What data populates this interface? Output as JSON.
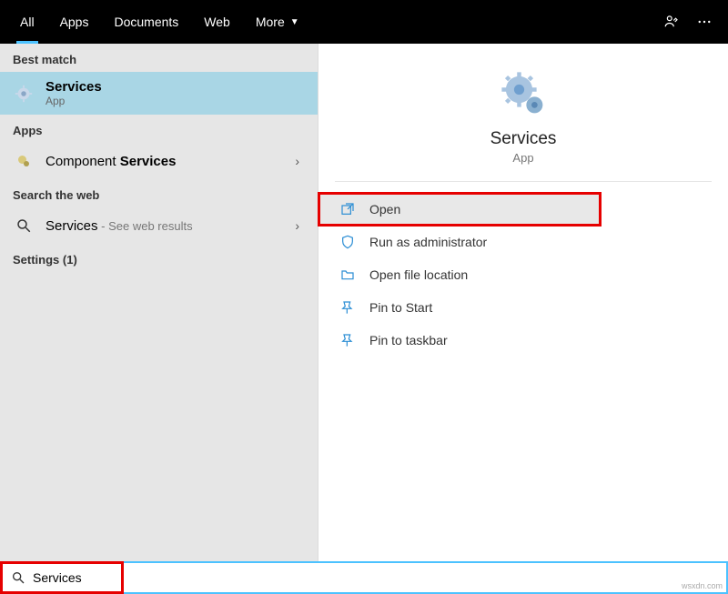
{
  "topbar": {
    "tabs": [
      "All",
      "Apps",
      "Documents",
      "Web",
      "More"
    ]
  },
  "left": {
    "best_match_label": "Best match",
    "best_match": {
      "title": "Services",
      "sub": "App"
    },
    "apps_label": "Apps",
    "apps_item": {
      "prefix": "Component ",
      "bold": "Services"
    },
    "web_label": "Search the web",
    "web_item": {
      "title": "Services",
      "suffix": " - See web results"
    },
    "settings_label": "Settings (1)"
  },
  "preview": {
    "title": "Services",
    "sub": "App"
  },
  "actions": {
    "open": "Open",
    "run_admin": "Run as administrator",
    "open_loc": "Open file location",
    "pin_start": "Pin to Start",
    "pin_taskbar": "Pin to taskbar"
  },
  "search": {
    "value": "Services"
  },
  "watermark": "wsxdn.com"
}
